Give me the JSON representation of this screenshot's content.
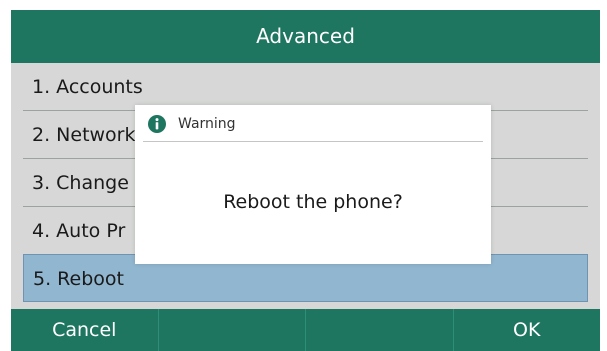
{
  "screen": {
    "title": "Advanced",
    "colors": {
      "title_bar": "#1e7560",
      "softkey_bar": "#1e7560",
      "background": "#d6d7d6",
      "selected_row": "#91b6cf",
      "info_icon": "#1e7560"
    }
  },
  "menu": {
    "items": [
      {
        "label": "1. Accounts"
      },
      {
        "label": "2. Network"
      },
      {
        "label": "3. Change"
      },
      {
        "label": "4. Auto Pr"
      },
      {
        "label": "5. Reboot"
      }
    ],
    "selected_index": 4
  },
  "dialog": {
    "icon": "info-icon",
    "title": "Warning",
    "message": "Reboot the phone?"
  },
  "softkeys": [
    {
      "label": "Cancel"
    },
    {
      "label": ""
    },
    {
      "label": ""
    },
    {
      "label": "OK"
    }
  ]
}
